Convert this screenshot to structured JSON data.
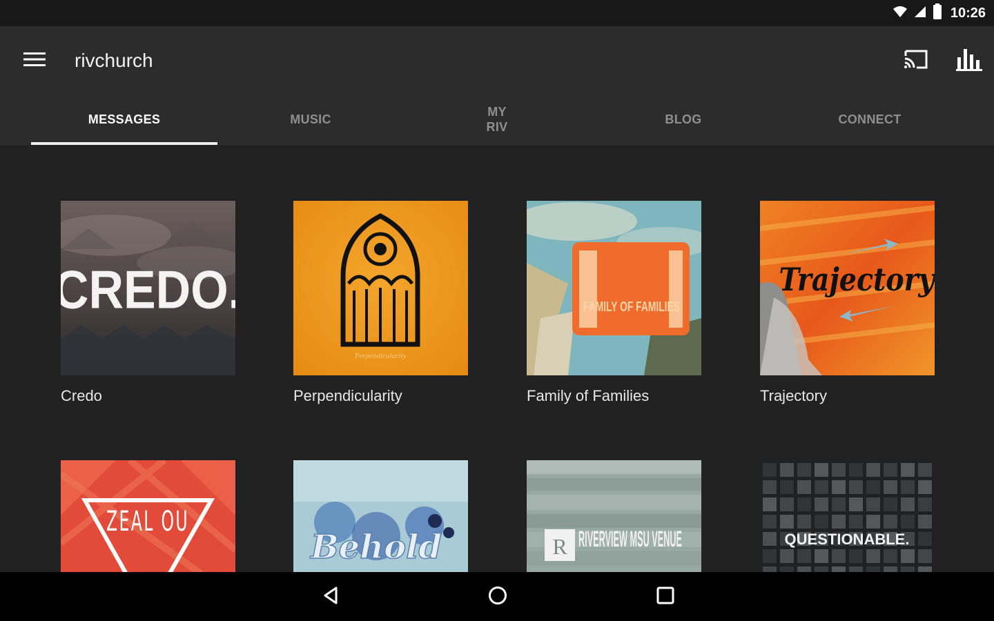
{
  "status": {
    "time": "10:26",
    "icons": [
      "wifi-icon",
      "signal-icon",
      "battery-icon"
    ]
  },
  "app_bar": {
    "title": "rivchurch",
    "icons": [
      "menu-icon",
      "cast-icon",
      "bar-chart-icon"
    ]
  },
  "tabs": [
    {
      "label": "MESSAGES",
      "active": true
    },
    {
      "label": "MUSIC",
      "active": false
    },
    {
      "label": "MY RIV",
      "active": false
    },
    {
      "label": "BLOG",
      "active": false
    },
    {
      "label": "CONNECT",
      "active": false
    }
  ],
  "series": [
    {
      "title": "Credo",
      "art_text": "CREDO."
    },
    {
      "title": "Perpendicularity",
      "art_text": "Perpendicularity"
    },
    {
      "title": "Family of Families",
      "art_text": "FAMILY OF FAMILIES"
    },
    {
      "title": "Trajectory",
      "art_text": "Trajectory"
    },
    {
      "title": "",
      "art_text": "ZEAL OU"
    },
    {
      "title": "",
      "art_text": "Behold"
    },
    {
      "title": "",
      "art_text": "RIVERVIEW MSU VENUE"
    },
    {
      "title": "",
      "art_text": "QUESTIONABLE."
    }
  ],
  "colors": {
    "background": "#212121",
    "app_bar": "#2c2c2c",
    "status_bar": "#181818",
    "nav_bar": "#000000",
    "tab_active": "#ffffff",
    "tab_inactive": "#8f8f8f"
  },
  "nav": {
    "icons": [
      "back-icon",
      "home-icon",
      "recents-icon"
    ]
  }
}
